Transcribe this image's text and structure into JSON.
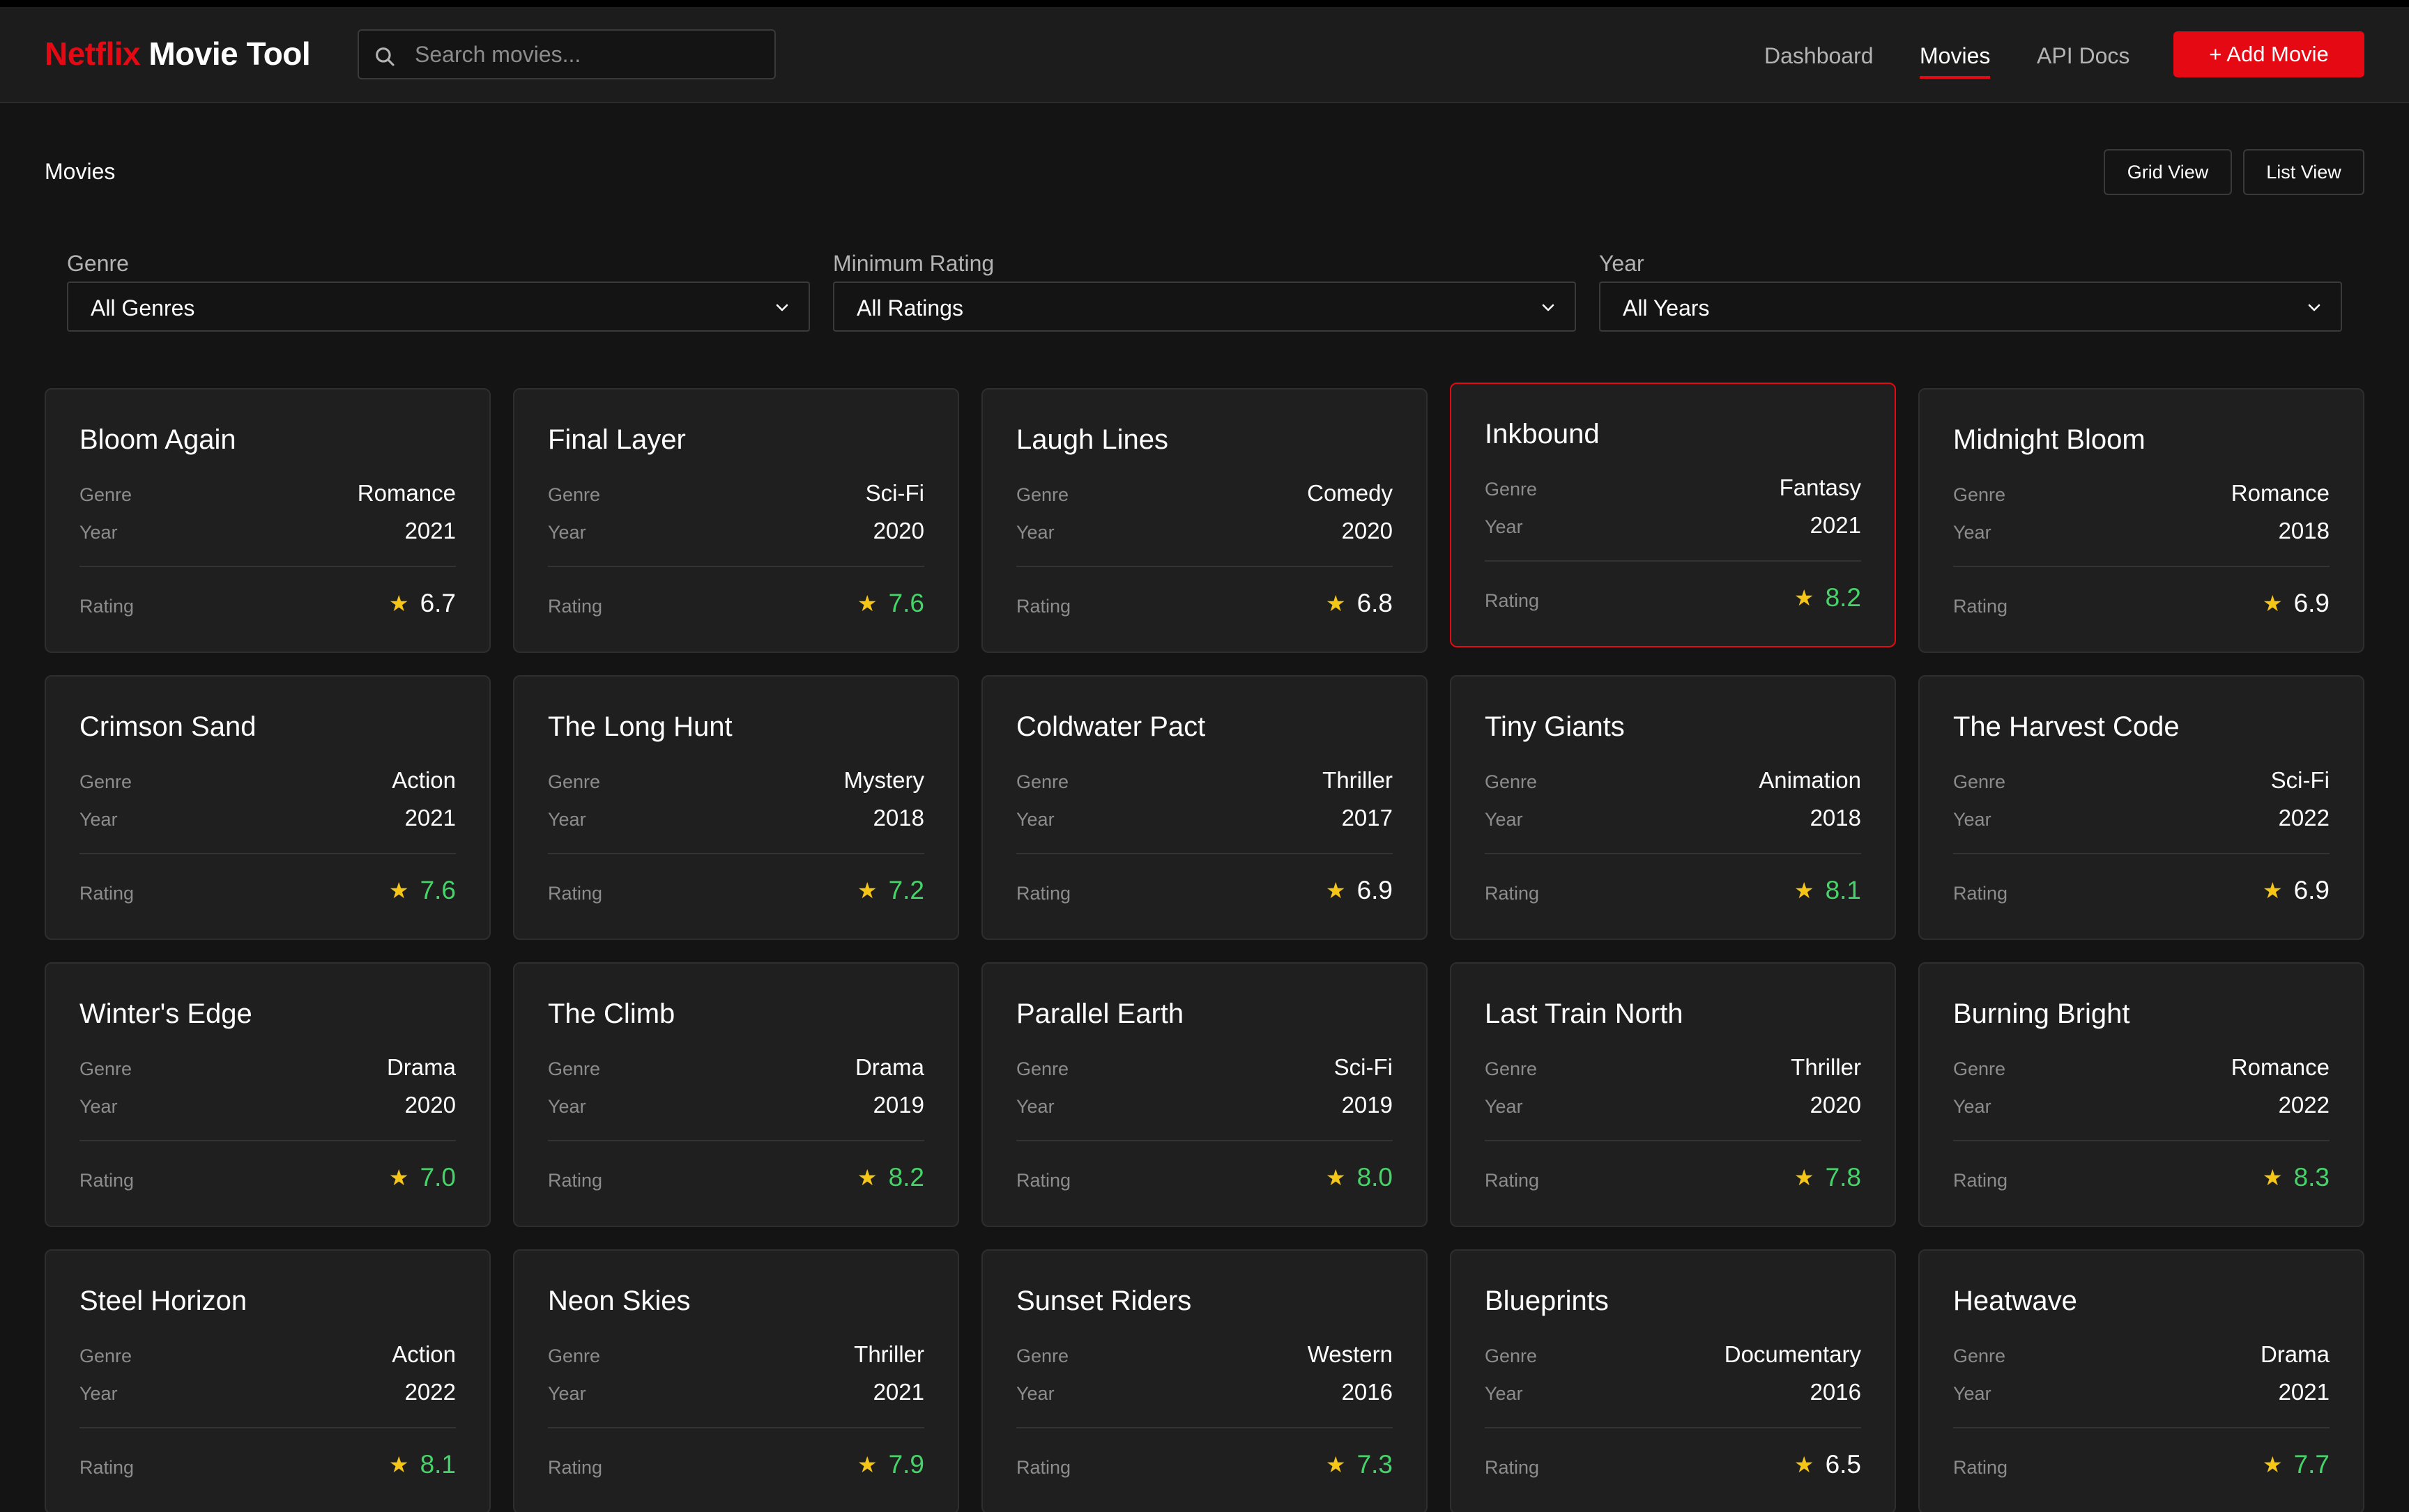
{
  "header": {
    "brand_red": "Netflix",
    "brand_white": "Movie Tool",
    "search_placeholder": "Search movies...",
    "nav": [
      {
        "label": "Dashboard",
        "active": false
      },
      {
        "label": "Movies",
        "active": true
      },
      {
        "label": "API Docs",
        "active": false
      }
    ],
    "add_button": "+ Add Movie"
  },
  "page": {
    "title": "Movies",
    "grid_view": "Grid View",
    "list_view": "List View"
  },
  "filters": [
    {
      "label": "Genre",
      "value": "All Genres"
    },
    {
      "label": "Minimum Rating",
      "value": "All Ratings"
    },
    {
      "label": "Year",
      "value": "All Years"
    }
  ],
  "labels": {
    "genre": "Genre",
    "year": "Year",
    "rating": "Rating"
  },
  "colors": {
    "accent": "#e50914",
    "high_rating": "#46d369",
    "star": "#f5c518"
  },
  "movies": [
    {
      "title": "Bloom Again",
      "genre": "Romance",
      "year": "2021",
      "rating": "6.7"
    },
    {
      "title": "Final Layer",
      "genre": "Sci-Fi",
      "year": "2020",
      "rating": "7.6"
    },
    {
      "title": "Laugh Lines",
      "genre": "Comedy",
      "year": "2020",
      "rating": "6.8"
    },
    {
      "title": "Inkbound",
      "genre": "Fantasy",
      "year": "2021",
      "rating": "8.2"
    },
    {
      "title": "Midnight Bloom",
      "genre": "Romance",
      "year": "2018",
      "rating": "6.9"
    },
    {
      "title": "Crimson Sand",
      "genre": "Action",
      "year": "2021",
      "rating": "7.6"
    },
    {
      "title": "The Long Hunt",
      "genre": "Mystery",
      "year": "2018",
      "rating": "7.2"
    },
    {
      "title": "Coldwater Pact",
      "genre": "Thriller",
      "year": "2017",
      "rating": "6.9"
    },
    {
      "title": "Tiny Giants",
      "genre": "Animation",
      "year": "2018",
      "rating": "8.1"
    },
    {
      "title": "The Harvest Code",
      "genre": "Sci-Fi",
      "year": "2022",
      "rating": "6.9"
    },
    {
      "title": "Winter's Edge",
      "genre": "Drama",
      "year": "2020",
      "rating": "7.0"
    },
    {
      "title": "The Climb",
      "genre": "Drama",
      "year": "2019",
      "rating": "8.2"
    },
    {
      "title": "Parallel Earth",
      "genre": "Sci-Fi",
      "year": "2019",
      "rating": "8.0"
    },
    {
      "title": "Last Train North",
      "genre": "Thriller",
      "year": "2020",
      "rating": "7.8"
    },
    {
      "title": "Burning Bright",
      "genre": "Romance",
      "year": "2022",
      "rating": "8.3"
    },
    {
      "title": "Steel Horizon",
      "genre": "Action",
      "year": "2022",
      "rating": "8.1"
    },
    {
      "title": "Neon Skies",
      "genre": "Thriller",
      "year": "2021",
      "rating": "7.9"
    },
    {
      "title": "Sunset Riders",
      "genre": "Western",
      "year": "2016",
      "rating": "7.3"
    },
    {
      "title": "Blueprints",
      "genre": "Documentary",
      "year": "2016",
      "rating": "6.5"
    },
    {
      "title": "Heatwave",
      "genre": "Drama",
      "year": "2021",
      "rating": "7.7"
    }
  ],
  "hovered_card": 3
}
